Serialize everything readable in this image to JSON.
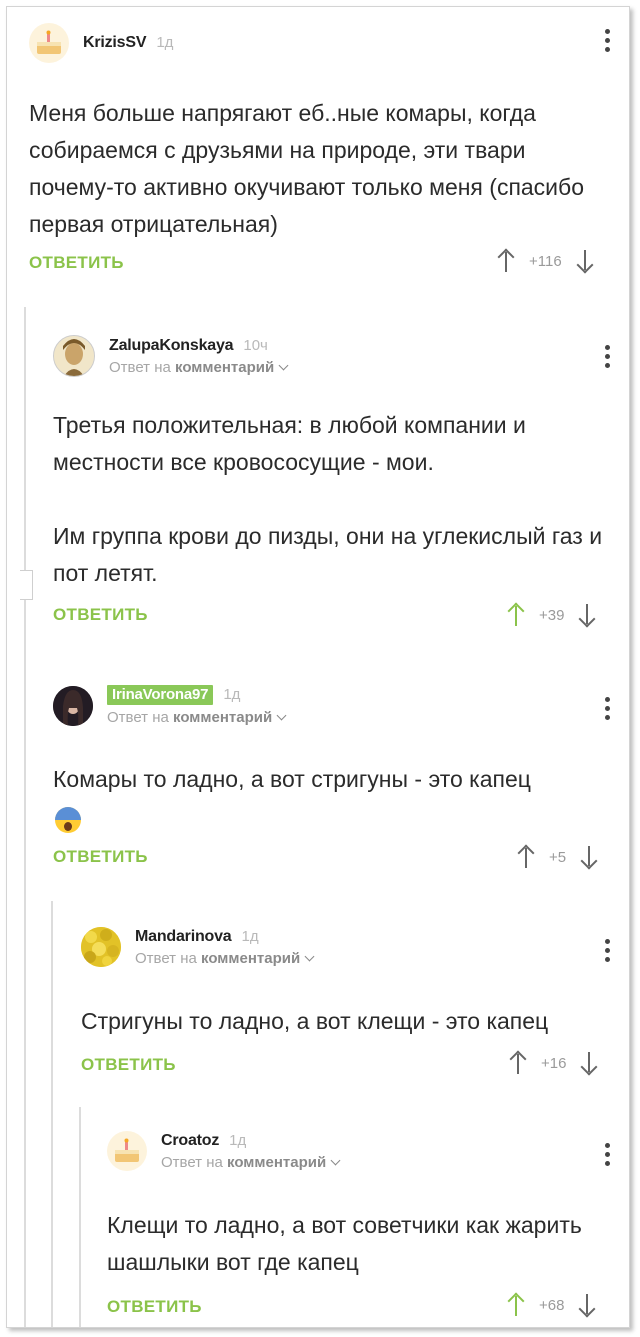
{
  "colors": {
    "accent": "#8bc34a",
    "username_tag": "#8ac858",
    "text": "#2b2b2b",
    "muted": "#a6a6a6"
  },
  "labels": {
    "reply": "ОТВЕТИТЬ",
    "reply_to_prefix": "Ответ на",
    "reply_to_target": "комментарий"
  },
  "comments": [
    {
      "username": "KrizisSV",
      "time": "1д",
      "reply_to": false,
      "avatar": "cake-avatar",
      "text": "Меня больше напрягают еб..ные комары, когда собираемся с друзьями на природе, эти твари почему-то активно окучивают только меня (спасибо первая отрицательная)",
      "score": "+116",
      "upvoted": false
    },
    {
      "username": "ZalupaKonskaya",
      "time": "10ч",
      "reply_to": true,
      "avatar": "portrait-avatar",
      "text": "Третья положительная: в любой компании и местности все кровососущие - мои.\n\nИм группа крови до пизды, они на углекислый газ и пот летят.",
      "score": "+39",
      "upvoted": true
    },
    {
      "username": "IrinaVorona97",
      "time": "1д",
      "reply_to": true,
      "avatar": "photo-avatar",
      "text": "Комары то ладно, а вот стригуны - это капец",
      "emoji": "screaming-face-emoji",
      "score": "+5",
      "upvoted": false
    },
    {
      "username": "Mandarinova",
      "time": "1д",
      "reply_to": true,
      "avatar": "fruit-avatar",
      "text": "Стригуны то ладно, а вот клещи - это капец",
      "score": "+16",
      "upvoted": false
    },
    {
      "username": "Croatoz",
      "time": "1д",
      "reply_to": true,
      "avatar": "cake-avatar",
      "text": "Клещи то ладно, а вот советчики как жарить шашлыки вот где капец",
      "score": "+68",
      "upvoted": true
    }
  ]
}
